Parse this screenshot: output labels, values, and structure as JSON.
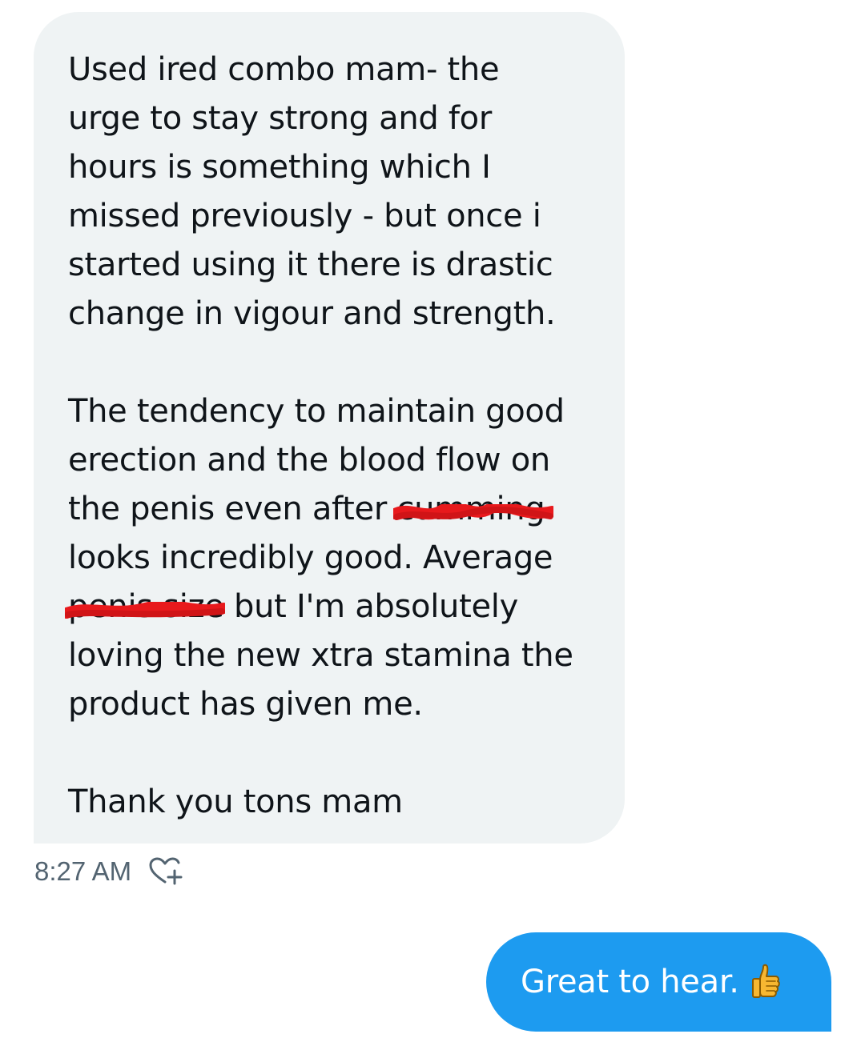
{
  "incoming_message": {
    "paragraph_1": [
      "Used ired combo mam- the",
      "urge to stay strong and for",
      "hours is something which I",
      "missed previously - but once i",
      "started using it there is drastic",
      "change in vigour and strength."
    ],
    "paragraph_2": {
      "line_1": "The tendency to maintain good",
      "line_2": "erection and the blood flow on",
      "line_3_before": "the penis even after ",
      "line_3_redacted": "cumming",
      "line_4": "looks incredibly good. Average",
      "line_5_redacted": "penis",
      "line_5_after": " size but I'm absolutely",
      "line_6": "loving the new xtra stamina the",
      "line_7": "product has given me."
    },
    "paragraph_3": "Thank you tons mam",
    "timestamp": "8:27 AM",
    "reaction_icon": "heart-add-icon"
  },
  "outgoing_message": {
    "text": "Great to hear.",
    "emoji": "thumbs-up-icon"
  },
  "colors": {
    "incoming_bubble": "#eff3f4",
    "outgoing_bubble": "#1d9bf0",
    "text": "#0f1419",
    "meta_text": "#536471",
    "redaction": "#e8191c"
  }
}
